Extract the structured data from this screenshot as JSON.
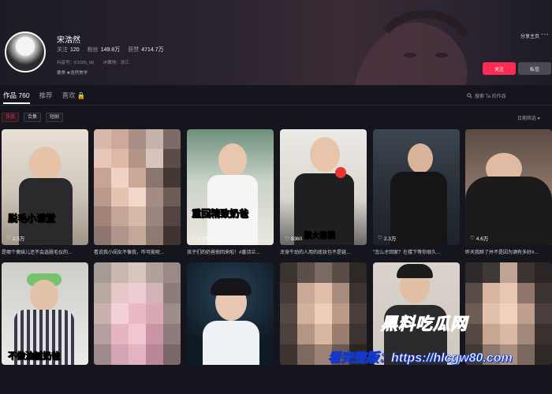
{
  "profile": {
    "name": "宋浩然",
    "following_label": "关注",
    "following_value": "120",
    "fans_label": "粉丝",
    "fans_value": "149.8万",
    "likes_label": "获赞",
    "likes_value": "4714.7万",
    "douyin_id": "抖音号：K1026_66",
    "ip_location": "IP属地：浙江",
    "bio": "要美 ❀浩然美学"
  },
  "header_actions": {
    "share": "分享主页",
    "more": "···",
    "follow": "关注",
    "message": "私信"
  },
  "tabs": [
    {
      "label": "作品 760"
    },
    {
      "label": "推荐"
    },
    {
      "label": "喜欢 🔒"
    }
  ],
  "search_placeholder": "搜索 Ta 的作品",
  "filters": [
    {
      "label": "作品"
    },
    {
      "label": "合集"
    },
    {
      "label": "短剧"
    }
  ],
  "date_filter": "日期筛选 ▾",
  "videos": [
    {
      "overlay": "脱毛小课堂",
      "likes": "2.5万",
      "caption": "是哪个傻妹儿还不会选脱毛仪的…"
    },
    {
      "overlay": "",
      "likes": "",
      "caption": "看说我小闺女不像我，咋可能呢…"
    },
    {
      "overlay": "重回精致奶爸",
      "likes": "1.0万",
      "caption": "孩子们的奶爸他回来啦！#番诗兰…"
    },
    {
      "overlay": "狠大喜报",
      "likes": "8360",
      "caption": "浑身牛劲的人用的底妆包不是链…"
    },
    {
      "overlay": "",
      "likes": "2.3万",
      "caption": "\"怎么才回家？在楼下等你很久…"
    },
    {
      "overlay": "",
      "likes": "4.6万",
      "caption": "昨天我醉了并不是因为酒有多好#…"
    },
    {
      "overlay": "不做油腻奶爸",
      "likes": "",
      "caption": ""
    },
    {
      "overlay": "",
      "likes": "",
      "caption": ""
    },
    {
      "overlay": "",
      "likes": "",
      "caption": ""
    },
    {
      "overlay": "",
      "likes": "",
      "caption": ""
    },
    {
      "overlay": "",
      "likes": "",
      "caption": ""
    },
    {
      "overlay": "",
      "likes": "",
      "caption": ""
    }
  ],
  "watermark": {
    "logo": "黑料吃瓜网",
    "url_line": "看完整版：https://hlcgw80.com"
  },
  "colors": {
    "accent": "#fe2c55",
    "background": "#15151d",
    "watermark_blue": "#1a5cff"
  }
}
